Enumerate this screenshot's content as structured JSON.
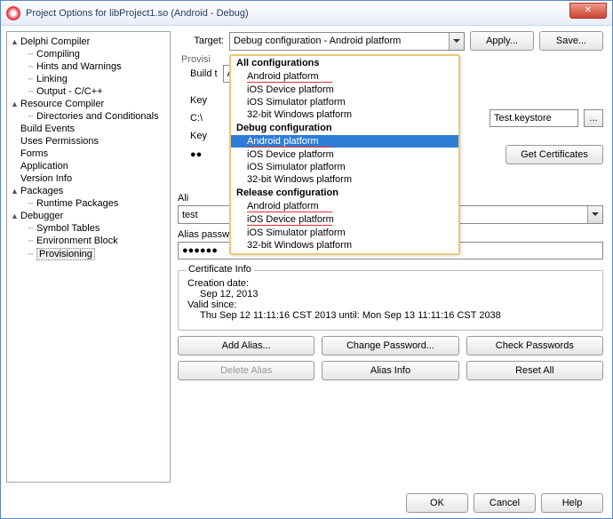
{
  "title": "Project Options for libProject1.so  (Android - Debug)",
  "tree": {
    "items": [
      {
        "label": "Delphi Compiler",
        "exp": "▲",
        "lvl": 0
      },
      {
        "label": "Compiling",
        "lvl": 1
      },
      {
        "label": "Hints and Warnings",
        "lvl": 1
      },
      {
        "label": "Linking",
        "lvl": 1
      },
      {
        "label": "Output - C/C++",
        "lvl": 1
      },
      {
        "label": "Resource Compiler",
        "exp": "▲",
        "lvl": 0
      },
      {
        "label": "Directories and Conditionals",
        "lvl": 1
      },
      {
        "label": "Build Events",
        "lvl": 0
      },
      {
        "label": "Uses Permissions",
        "lvl": 0
      },
      {
        "label": "Forms",
        "lvl": 0
      },
      {
        "label": "Application",
        "lvl": 0
      },
      {
        "label": "Version Info",
        "lvl": 0
      },
      {
        "label": "Packages",
        "exp": "▲",
        "lvl": 0
      },
      {
        "label": "Runtime Packages",
        "lvl": 1
      },
      {
        "label": "Debugger",
        "exp": "▲",
        "lvl": 0
      },
      {
        "label": "Symbol Tables",
        "lvl": 1
      },
      {
        "label": "Environment Block",
        "lvl": 1
      },
      {
        "label": "Provisioning",
        "lvl": 1,
        "selected": true
      }
    ]
  },
  "target": {
    "label": "Target:",
    "value": "Debug configuration - Android platform"
  },
  "apply": "Apply...",
  "save": "Save...",
  "provis_label": "Provisi",
  "build_label": "Build t",
  "build_value": "Andro",
  "key_label": "Key",
  "c_label": "C:\\",
  "c_value": "Test.keystore",
  "key2_label": "Key",
  "pw_mask": "●●",
  "get_cert": "Get Certificates",
  "alias_label_trunc": "Ali",
  "alias_value": "test",
  "alias_pw_label": "Alias password:",
  "alias_pw_value": "●●●●●●",
  "cert_title": "Certificate Info",
  "cert_creation_lbl": "Creation date:",
  "cert_creation_val": "Sep 12, 2013",
  "cert_valid_lbl": "Valid since:",
  "cert_valid_val": "Thu Sep 12 11:11:16 CST 2013 until: Mon Sep 13 11:11:16 CST 2038",
  "btns": {
    "add_alias": "Add Alias...",
    "change_pw": "Change Password...",
    "check_pw": "Check Passwords",
    "delete_alias": "Delete Alias",
    "alias_info": "Alias Info",
    "reset_all": "Reset All"
  },
  "footer": {
    "ok": "OK",
    "cancel": "Cancel",
    "help": "Help"
  },
  "dropdown": {
    "groups": [
      {
        "title": "All configurations",
        "items": [
          "Android platform",
          "iOS Device platform",
          "iOS Simulator platform",
          "32-bit Windows platform"
        ]
      },
      {
        "title": "Debug configuration",
        "items": [
          "Android platform",
          "iOS Device platform",
          "iOS Simulator platform",
          "32-bit Windows platform"
        ]
      },
      {
        "title": "Release configuration",
        "items": [
          "Android platform",
          "iOS Device platform",
          "iOS Simulator platform",
          "32-bit Windows platform"
        ]
      }
    ],
    "highlight": "Android platform"
  }
}
